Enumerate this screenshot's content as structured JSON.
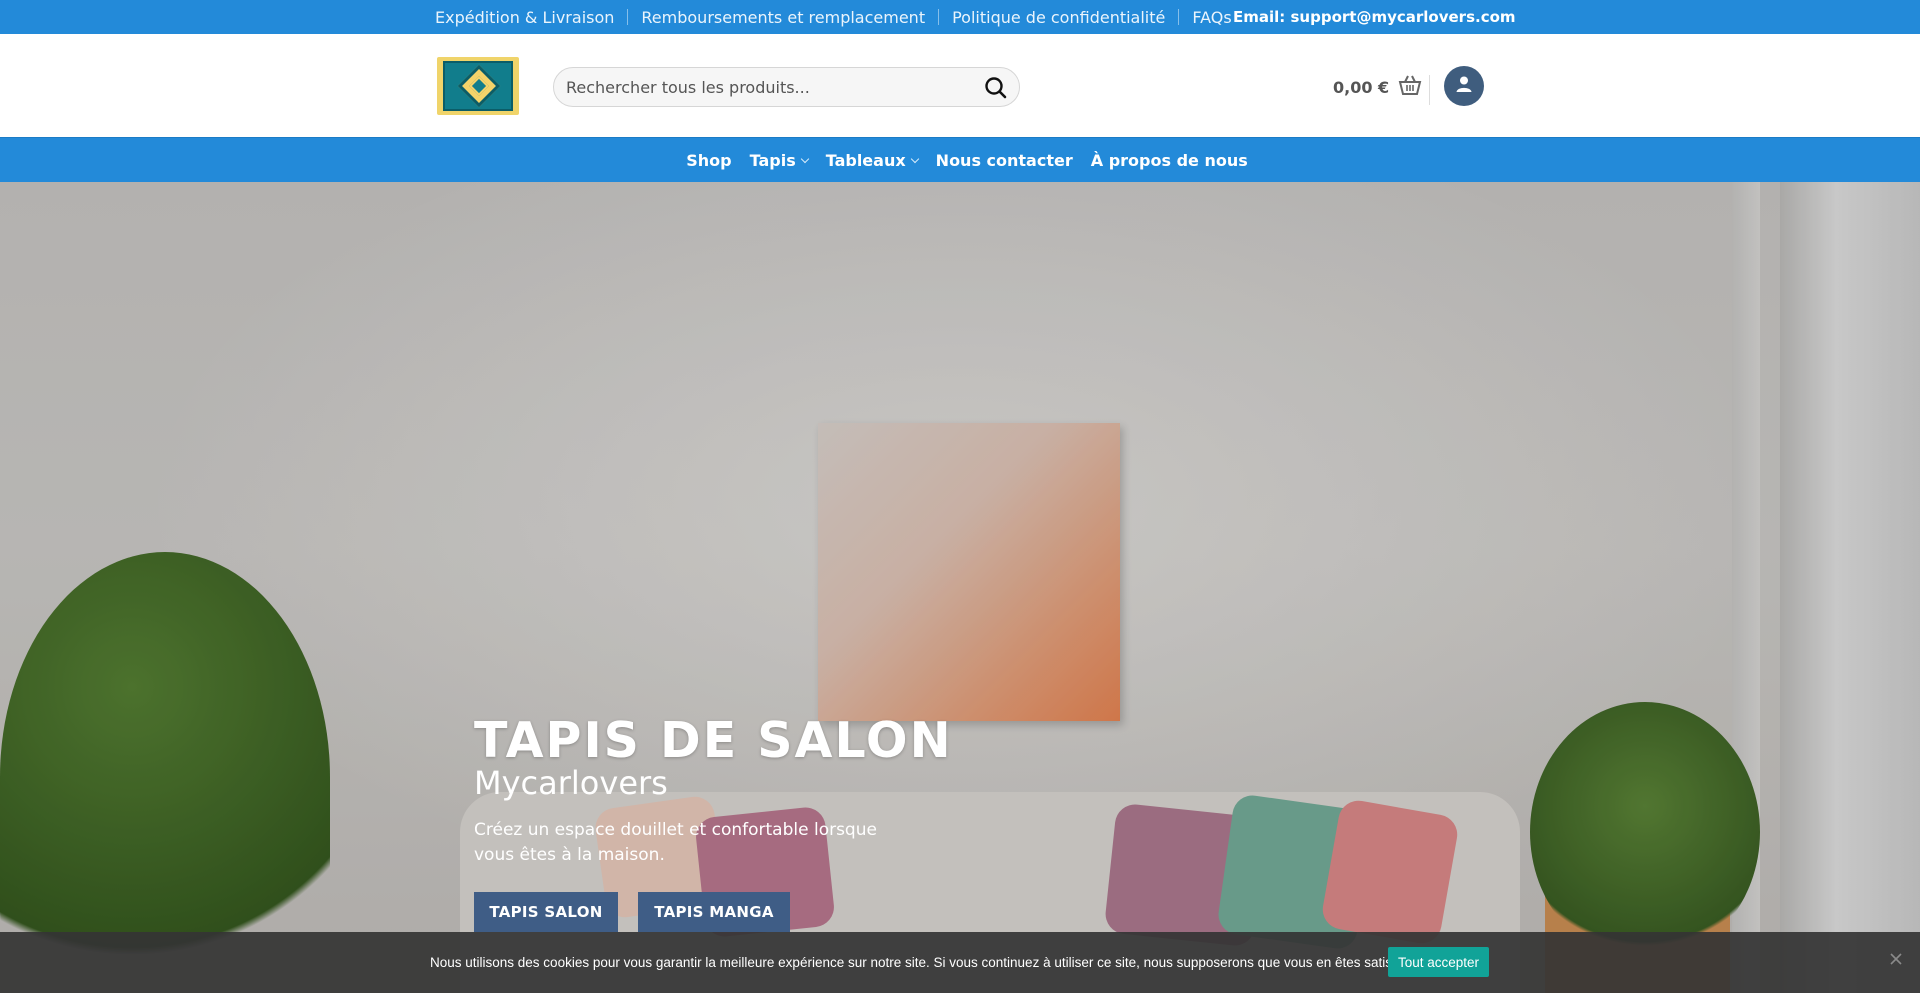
{
  "topbar": {
    "links": [
      "Expédition & Livraison",
      "Remboursements et remplacement",
      "Politique de confidentialité",
      "FAQs"
    ],
    "email": "Email: support@mycarlovers.com"
  },
  "header": {
    "logo_icon": "rug-logo",
    "search_placeholder": "Rechercher tous les produits...",
    "search_icon": "search-icon",
    "cart_total": "0,00 €",
    "cart_icon": "basket-icon",
    "account_icon": "user-icon"
  },
  "nav": {
    "items": [
      {
        "label": "Shop",
        "dropdown": false
      },
      {
        "label": "Tapis",
        "dropdown": true
      },
      {
        "label": "Tableaux",
        "dropdown": true
      },
      {
        "label": "Nous contacter",
        "dropdown": false
      },
      {
        "label": "À propos de nous",
        "dropdown": false
      }
    ]
  },
  "hero": {
    "title": "TAPIS DE SALON",
    "subtitle": "Mycarlovers",
    "description": "Créez un espace douillet et confortable lorsque vous êtes à la maison.",
    "buttons": [
      "TAPIS SALON",
      "TAPIS MANGA"
    ]
  },
  "cookie": {
    "message": "Nous utilisons des cookies pour vous garantir la meilleure expérience sur notre site. Si vous continuez à utiliser ce site, nous supposerons que vous en êtes satisfait.",
    "accept_label": "Tout accepter",
    "close_icon": "close-icon"
  },
  "colors": {
    "brand_blue": "#238ad9",
    "button_blue": "#3f5d86",
    "accept_teal": "#11a398"
  }
}
